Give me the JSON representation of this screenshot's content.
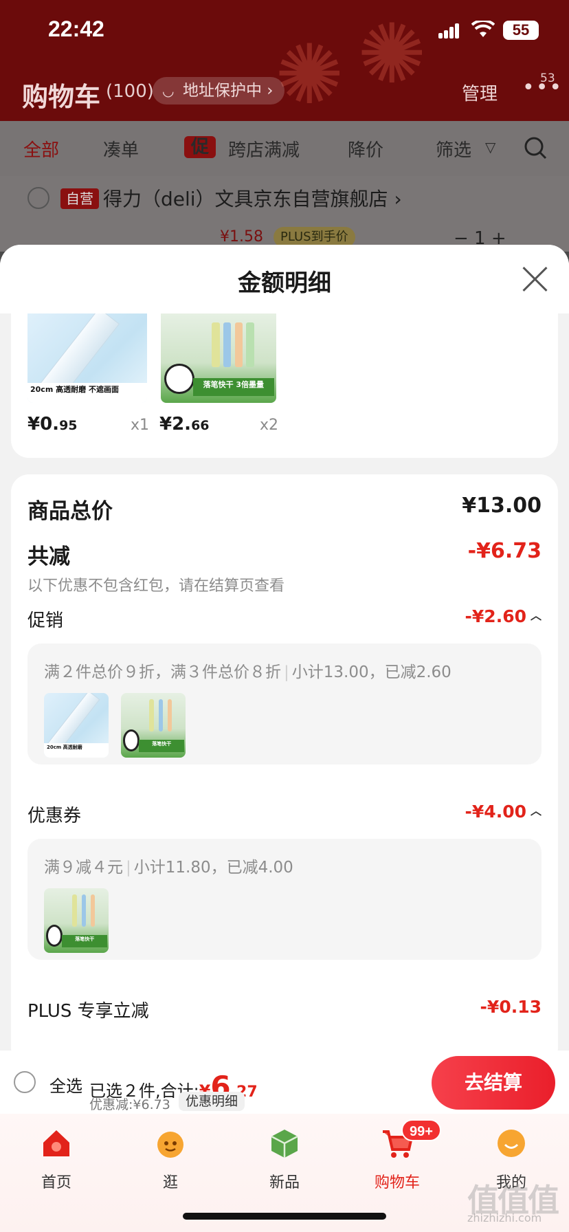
{
  "status_bar": {
    "time": "22:42",
    "battery": "55"
  },
  "cart_header": {
    "title": "购物车",
    "count": "(100)",
    "address_protect": "地址保护中 ›",
    "manage": "管理",
    "more": "•••",
    "more_badge": "53"
  },
  "filter_tabs": [
    {
      "label": "全部"
    },
    {
      "label": "凑单"
    },
    {
      "label": "跨店满减",
      "tag": "促"
    },
    {
      "label": "降价"
    },
    {
      "label": "筛选"
    }
  ],
  "store": {
    "tag": "自营",
    "name": "得力（deli）文具京东自营旗舰店 ›",
    "strip_price": "¥1.58",
    "strip_plus": "PLUS到手价",
    "strip_qty": "−    1    +"
  },
  "sheet": {
    "title": "金额明细",
    "items": [
      {
        "price_int": "¥0.",
        "price_dec": "95",
        "qty": "x1",
        "image_tag": "20cm 高透耐磨 不遮画面"
      },
      {
        "price_int": "¥2.",
        "price_dec": "66",
        "qty": "x2",
        "image_tag": "落笔快干  3倍墨量"
      }
    ],
    "total_label": "商品总价",
    "total_value": "¥13.00",
    "discount_label": "共减",
    "discount_value": "-¥6.73",
    "discount_note": "以下优惠不包含红包，请在结算页查看",
    "promo": {
      "label": "促销",
      "value": "-¥2.60",
      "rule": "满２件总价９折，满３件总价８折",
      "detail": "小计13.00，已减2.60"
    },
    "coupon": {
      "label": "优惠券",
      "value": "-¥4.00",
      "rule": "满９减４元",
      "detail": "小计11.80，已减4.00"
    },
    "plus": {
      "label": "PLUS 专享立减",
      "value": "-¥0.13"
    }
  },
  "checkout": {
    "select_all": "全选",
    "selected": "已选２件,合计:",
    "total_symbol": "¥",
    "total_int": "6",
    "total_dec": ".27",
    "discount": "优惠减:¥6.73",
    "discount_detail": "优惠明细",
    "pay_button": "去结算"
  },
  "tabbar": {
    "items": [
      {
        "label": "首页"
      },
      {
        "label": "逛"
      },
      {
        "label": "新品"
      },
      {
        "label": "购物车"
      },
      {
        "label": "我的"
      }
    ],
    "cart_badge": "99+"
  },
  "watermark": {
    "text": "值值值",
    "url": "zhizhizhi.com"
  },
  "colors": {
    "accent": "#e2231a",
    "header_bg": "#6b0b0b",
    "sheet_bg": "#f2f2f2"
  }
}
